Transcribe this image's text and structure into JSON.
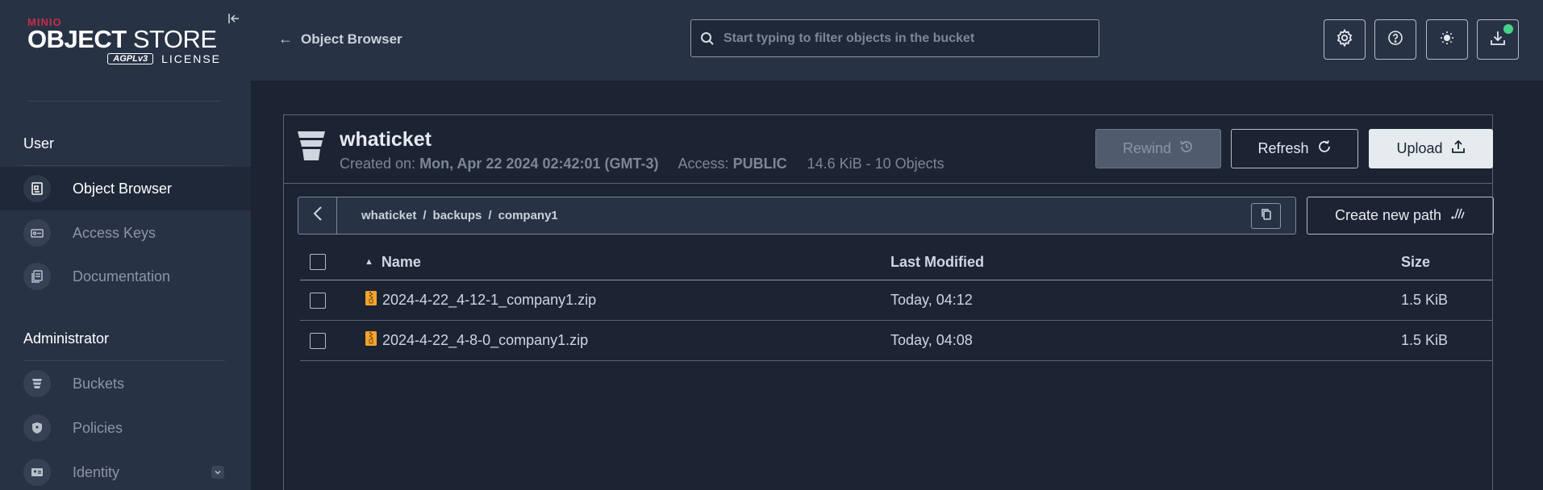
{
  "sidebar": {
    "logo": {
      "brand": "MINIO",
      "title_bold": "OBJECT",
      "title_light": " STORE",
      "agpl": "AGPLv3",
      "license": "LICENSE"
    },
    "sections": [
      {
        "title": "User",
        "items": [
          {
            "label": "Object Browser",
            "icon": "object-browser-icon",
            "active": true
          },
          {
            "label": "Access Keys",
            "icon": "key-icon"
          },
          {
            "label": "Documentation",
            "icon": "docs-icon"
          }
        ]
      },
      {
        "title": "Administrator",
        "items": [
          {
            "label": "Buckets",
            "icon": "bucket-icon"
          },
          {
            "label": "Policies",
            "icon": "shield-icon"
          },
          {
            "label": "Identity",
            "icon": "identity-icon"
          }
        ]
      }
    ]
  },
  "header": {
    "back_label": "Object Browser",
    "search_placeholder": "Start typing to filter objects in the bucket"
  },
  "bucket": {
    "name": "whaticket",
    "created_label": "Created on:",
    "created_value": "Mon, Apr 22 2024 02:42:01 (GMT-3)",
    "access_label": "Access:",
    "access_value": "PUBLIC",
    "summary": "14.6 KiB - 10 Objects"
  },
  "actions": {
    "rewind": "Rewind",
    "refresh": "Refresh",
    "upload": "Upload",
    "create_path": "Create new path"
  },
  "breadcrumbs": [
    "whaticket",
    "backups",
    "company1"
  ],
  "table": {
    "columns": {
      "name": "Name",
      "modified": "Last Modified",
      "size": "Size"
    },
    "rows": [
      {
        "name": "2024-4-22_4-12-1_company1.zip",
        "modified": "Today, 04:12",
        "size": "1.5 KiB"
      },
      {
        "name": "2024-4-22_4-8-0_company1.zip",
        "modified": "Today, 04:08",
        "size": "1.5 KiB"
      }
    ]
  }
}
